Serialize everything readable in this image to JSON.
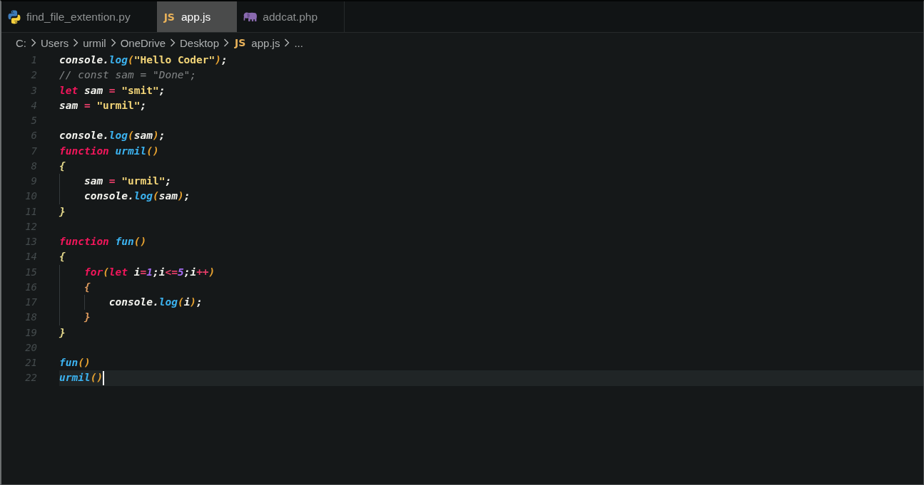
{
  "tabs": [
    {
      "kind": "python",
      "label": "find_file_extention.py",
      "selected": false
    },
    {
      "kind": "js",
      "icon_text": "JS",
      "label": "app.js",
      "selected": true
    },
    {
      "kind": "php",
      "label": "addcat.php",
      "selected": false
    }
  ],
  "breadcrumb": [
    {
      "label": "C:"
    },
    {
      "label": "Users"
    },
    {
      "label": "urmil"
    },
    {
      "label": "OneDrive"
    },
    {
      "label": "Desktop"
    },
    {
      "icon_text": "JS",
      "label": "app.js"
    },
    {
      "label": "..."
    }
  ],
  "lines": [
    {
      "number": "1",
      "current": false,
      "tokens": [
        {
          "kind": "plain",
          "text": "console."
        },
        {
          "kind": "function",
          "text": "log"
        },
        {
          "kind": "paren",
          "text": "("
        },
        {
          "kind": "string",
          "text": "\"Hello Coder\""
        },
        {
          "kind": "paren",
          "text": ")"
        },
        {
          "kind": "plain",
          "text": ";"
        }
      ]
    },
    {
      "number": "2",
      "current": false,
      "tokens": [
        {
          "kind": "comment",
          "text": "// const sam = \"Done\";"
        }
      ]
    },
    {
      "number": "3",
      "current": false,
      "tokens": [
        {
          "kind": "keyword",
          "text": "let"
        },
        {
          "kind": "plain",
          "text": " sam "
        },
        {
          "kind": "operator",
          "text": "="
        },
        {
          "kind": "string",
          "text": " \"smit\""
        },
        {
          "kind": "plain",
          "text": ";"
        }
      ]
    },
    {
      "number": "4",
      "current": false,
      "tokens": [
        {
          "kind": "plain",
          "text": "sam "
        },
        {
          "kind": "operator",
          "text": "="
        },
        {
          "kind": "string",
          "text": " \"urmil\""
        },
        {
          "kind": "plain",
          "text": ";"
        }
      ]
    },
    {
      "number": "5",
      "current": false
    },
    {
      "number": "6",
      "current": false,
      "tokens": [
        {
          "kind": "plain",
          "text": "console."
        },
        {
          "kind": "function",
          "text": "log"
        },
        {
          "kind": "paren",
          "text": "("
        },
        {
          "kind": "plain",
          "text": "sam"
        },
        {
          "kind": "paren",
          "text": ")"
        },
        {
          "kind": "plain",
          "text": ";"
        }
      ]
    },
    {
      "number": "7",
      "current": false,
      "tokens": [
        {
          "kind": "keyword",
          "text": "function"
        },
        {
          "kind": "function",
          "text": " urmil"
        },
        {
          "kind": "paren",
          "text": "()"
        }
      ]
    },
    {
      "number": "8",
      "current": false,
      "tokens": [
        {
          "kind": "brace",
          "text": "{"
        }
      ]
    },
    {
      "number": "9",
      "current": false,
      "tokens": [
        {
          "kind": "plain",
          "text": "    sam "
        },
        {
          "kind": "operator",
          "text": "="
        },
        {
          "kind": "string",
          "text": " \"urmil\""
        },
        {
          "kind": "plain",
          "text": ";"
        }
      ]
    },
    {
      "number": "10",
      "current": false,
      "tokens": [
        {
          "kind": "plain",
          "text": "    console."
        },
        {
          "kind": "function",
          "text": "log"
        },
        {
          "kind": "paren",
          "text": "("
        },
        {
          "kind": "plain",
          "text": "sam"
        },
        {
          "kind": "paren",
          "text": ")"
        },
        {
          "kind": "plain",
          "text": ";"
        }
      ]
    },
    {
      "number": "11",
      "current": false,
      "tokens": [
        {
          "kind": "brace",
          "text": "}"
        }
      ]
    },
    {
      "number": "12",
      "current": false
    },
    {
      "number": "13",
      "current": false,
      "tokens": [
        {
          "kind": "keyword",
          "text": "function"
        },
        {
          "kind": "function",
          "text": " fun"
        },
        {
          "kind": "paren",
          "text": "()"
        }
      ]
    },
    {
      "number": "14",
      "current": false,
      "tokens": [
        {
          "kind": "brace",
          "text": "{"
        }
      ]
    },
    {
      "number": "15",
      "current": false,
      "tokens": [
        {
          "kind": "keyword",
          "text": "    for"
        },
        {
          "kind": "paren",
          "text": "("
        },
        {
          "kind": "keyword",
          "text": "let"
        },
        {
          "kind": "plain",
          "text": " i"
        },
        {
          "kind": "operator",
          "text": "="
        },
        {
          "kind": "number",
          "text": "1"
        },
        {
          "kind": "plain",
          "text": ";i"
        },
        {
          "kind": "operator",
          "text": "<="
        },
        {
          "kind": "number",
          "text": "5"
        },
        {
          "kind": "plain",
          "text": ";i"
        },
        {
          "kind": "operator",
          "text": "++"
        },
        {
          "kind": "paren",
          "text": ")"
        }
      ]
    },
    {
      "number": "16",
      "current": false,
      "tokens": [
        {
          "kind": "innerbrace",
          "text": "    {"
        }
      ]
    },
    {
      "number": "17",
      "current": false,
      "tokens": [
        {
          "kind": "plain",
          "text": "        console."
        },
        {
          "kind": "function",
          "text": "log"
        },
        {
          "kind": "paren",
          "text": "("
        },
        {
          "kind": "plain",
          "text": "i"
        },
        {
          "kind": "paren",
          "text": ")"
        },
        {
          "kind": "plain",
          "text": ";"
        }
      ]
    },
    {
      "number": "18",
      "current": false,
      "tokens": [
        {
          "kind": "innerbrace",
          "text": "    }"
        }
      ]
    },
    {
      "number": "19",
      "current": false,
      "tokens": [
        {
          "kind": "brace",
          "text": "}"
        }
      ]
    },
    {
      "number": "20",
      "current": false
    },
    {
      "number": "21",
      "current": false,
      "tokens": [
        {
          "kind": "function",
          "text": "fun"
        },
        {
          "kind": "paren",
          "text": "()"
        }
      ]
    },
    {
      "number": "22",
      "current": true,
      "tokens": [
        {
          "kind": "function",
          "text": "urmil"
        },
        {
          "kind": "paren",
          "text": "()"
        }
      ]
    }
  ]
}
